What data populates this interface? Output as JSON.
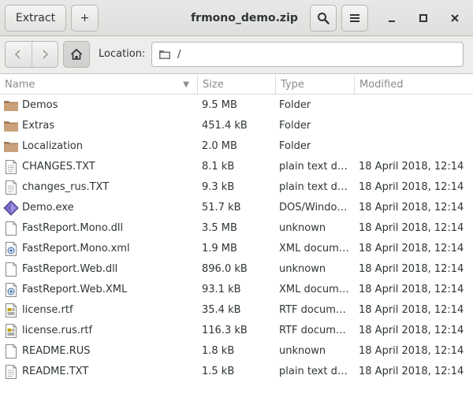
{
  "header": {
    "extract_label": "Extract",
    "add_label": "+",
    "title": "frmono_demo.zip"
  },
  "toolbar": {
    "location_label": "Location:",
    "location_value": "/"
  },
  "columns": {
    "name": "Name",
    "size": "Size",
    "type": "Type",
    "modified": "Modified"
  },
  "colors": {
    "folder": "#c9a27c",
    "folder_dark": "#a57f5b",
    "exe": "#7b68c8",
    "xml": "#3465a4",
    "rtf": "#c4a000"
  },
  "files": [
    {
      "icon": "folder-icon",
      "name": "Demos",
      "size": "9.5 MB",
      "type": "Folder",
      "modified": ""
    },
    {
      "icon": "folder-icon",
      "name": "Extras",
      "size": "451.4 kB",
      "type": "Folder",
      "modified": ""
    },
    {
      "icon": "folder-icon",
      "name": "Localization",
      "size": "2.0 MB",
      "type": "Folder",
      "modified": ""
    },
    {
      "icon": "text-file-icon",
      "name": "CHANGES.TXT",
      "size": "8.1 kB",
      "type": "plain text document",
      "modified": "18 April 2018, 12:14"
    },
    {
      "icon": "text-file-icon",
      "name": "changes_rus.TXT",
      "size": "9.3 kB",
      "type": "plain text document",
      "modified": "18 April 2018, 12:14"
    },
    {
      "icon": "executable-icon",
      "name": "Demo.exe",
      "size": "51.7 kB",
      "type": "DOS/Windows executable",
      "modified": "18 April 2018, 12:14"
    },
    {
      "icon": "file-icon",
      "name": "FastReport.Mono.dll",
      "size": "3.5 MB",
      "type": "unknown",
      "modified": "18 April 2018, 12:14"
    },
    {
      "icon": "xml-file-icon",
      "name": "FastReport.Mono.xml",
      "size": "1.9 MB",
      "type": "XML document",
      "modified": "18 April 2018, 12:14"
    },
    {
      "icon": "file-icon",
      "name": "FastReport.Web.dll",
      "size": "896.0 kB",
      "type": "unknown",
      "modified": "18 April 2018, 12:14"
    },
    {
      "icon": "xml-file-icon",
      "name": "FastReport.Web.XML",
      "size": "93.1 kB",
      "type": "XML document",
      "modified": "18 April 2018, 12:14"
    },
    {
      "icon": "rtf-file-icon",
      "name": "license.rtf",
      "size": "35.4 kB",
      "type": "RTF document",
      "modified": "18 April 2018, 12:14"
    },
    {
      "icon": "rtf-file-icon",
      "name": "license.rus.rtf",
      "size": "116.3 kB",
      "type": "RTF document",
      "modified": "18 April 2018, 12:14"
    },
    {
      "icon": "file-icon",
      "name": "README.RUS",
      "size": "1.8 kB",
      "type": "unknown",
      "modified": "18 April 2018, 12:14"
    },
    {
      "icon": "text-file-icon",
      "name": "README.TXT",
      "size": "1.5 kB",
      "type": "plain text document",
      "modified": "18 April 2018, 12:14"
    }
  ]
}
